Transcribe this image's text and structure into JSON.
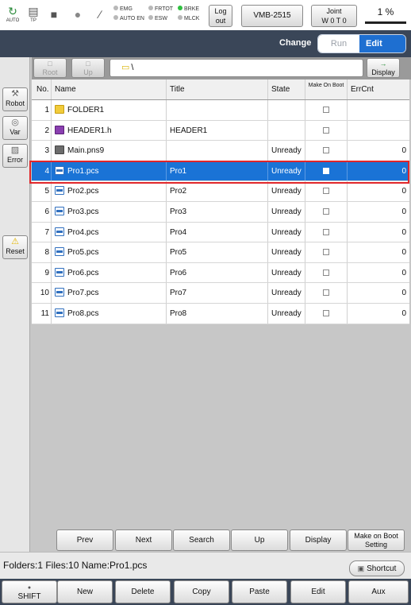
{
  "status_icons": [
    {
      "icon": "auto-mode-icon",
      "label": "AUTO"
    },
    {
      "icon": "teach-pendant-icon",
      "label": "TP"
    },
    {
      "icon": "stop-square-icon",
      "label": ""
    },
    {
      "icon": "lamp-icon",
      "label": ""
    },
    {
      "icon": "wrench-icon",
      "label": ""
    }
  ],
  "leds": [
    {
      "label": "EMG",
      "on": false
    },
    {
      "label": "FRTOT",
      "on": false
    },
    {
      "label": "BRKE",
      "on": true
    },
    {
      "label": "AUTO EN",
      "on": false
    },
    {
      "label": "ESW",
      "on": false
    },
    {
      "label": "MLCK",
      "on": false
    }
  ],
  "header": {
    "logout_label": "Log out",
    "robot_model": "VMB-2515",
    "joint_label": "Joint",
    "joint_value": "W 0 T 0",
    "speed": "1 %"
  },
  "mode": {
    "change_label": "Change",
    "run_label": "Run",
    "edit_label": "Edit",
    "active": "Edit"
  },
  "side_buttons": [
    {
      "icon": "robot-icon",
      "label": "Robot"
    },
    {
      "icon": "variable-icon",
      "label": "Var"
    },
    {
      "icon": "error-icon",
      "label": "Error"
    },
    {
      "icon": "warning-icon",
      "label": "Reset"
    }
  ],
  "path_bar": {
    "root_label": "Root",
    "up_label": "Up",
    "path": "\\",
    "display_label": "Display"
  },
  "table": {
    "columns": [
      "No.",
      "Name",
      "Title",
      "State",
      "Make On Boot",
      "ErrCnt"
    ],
    "rows": [
      {
        "no": "1",
        "icon": "folder-icon",
        "name": "FOLDER1",
        "title": "",
        "state": "",
        "make_on_boot": false,
        "errcnt": ""
      },
      {
        "no": "2",
        "icon": "header-file-icon",
        "name": "HEADER1.h",
        "title": "HEADER1",
        "state": "",
        "make_on_boot": false,
        "errcnt": ""
      },
      {
        "no": "3",
        "icon": "pns-file-icon",
        "name": "Main.pns9",
        "title": "",
        "state": "Unready",
        "make_on_boot": false,
        "errcnt": "0"
      },
      {
        "no": "4",
        "icon": "pcs-file-icon",
        "name": "Pro1.pcs",
        "title": "Pro1",
        "state": "Unready",
        "make_on_boot": false,
        "errcnt": "0",
        "selected": true
      },
      {
        "no": "5",
        "icon": "pcs-file-icon",
        "name": "Pro2.pcs",
        "title": "Pro2",
        "state": "Unready",
        "make_on_boot": false,
        "errcnt": "0"
      },
      {
        "no": "6",
        "icon": "pcs-file-icon",
        "name": "Pro3.pcs",
        "title": "Pro3",
        "state": "Unready",
        "make_on_boot": false,
        "errcnt": "0"
      },
      {
        "no": "7",
        "icon": "pcs-file-icon",
        "name": "Pro4.pcs",
        "title": "Pro4",
        "state": "Unready",
        "make_on_boot": false,
        "errcnt": "0"
      },
      {
        "no": "8",
        "icon": "pcs-file-icon",
        "name": "Pro5.pcs",
        "title": "Pro5",
        "state": "Unready",
        "make_on_boot": false,
        "errcnt": "0"
      },
      {
        "no": "9",
        "icon": "pcs-file-icon",
        "name": "Pro6.pcs",
        "title": "Pro6",
        "state": "Unready",
        "make_on_boot": false,
        "errcnt": "0"
      },
      {
        "no": "10",
        "icon": "pcs-file-icon",
        "name": "Pro7.pcs",
        "title": "Pro7",
        "state": "Unready",
        "make_on_boot": false,
        "errcnt": "0"
      },
      {
        "no": "11",
        "icon": "pcs-file-icon",
        "name": "Pro8.pcs",
        "title": "Pro8",
        "state": "Unready",
        "make_on_boot": false,
        "errcnt": "0"
      }
    ]
  },
  "list_buttons": [
    "Prev",
    "Next",
    "Search",
    "Up",
    "Display",
    "Make on Boot Setting"
  ],
  "status": {
    "text": "Folders:1  Files:10  Name:Pro1.pcs",
    "shortcut_label": "Shortcut"
  },
  "bottom_buttons": [
    "SHIFT",
    "New",
    "Delete",
    "Copy",
    "Paste",
    "Edit",
    "Aux"
  ],
  "colors": {
    "selection": "#1a73d6",
    "highlight_frame": "#e0262a",
    "mode_bar": "#3a4658",
    "edit_active": "#1e6fd1"
  }
}
